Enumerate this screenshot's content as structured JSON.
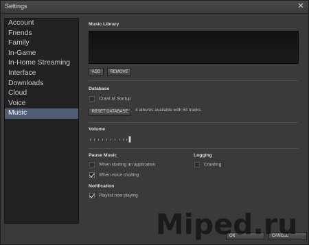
{
  "window": {
    "title": "Settings",
    "close_glyph": "✕"
  },
  "sidebar": {
    "items": [
      {
        "label": "Account"
      },
      {
        "label": "Friends"
      },
      {
        "label": "Family"
      },
      {
        "label": "In-Game"
      },
      {
        "label": "In-Home Streaming"
      },
      {
        "label": "Interface"
      },
      {
        "label": "Downloads"
      },
      {
        "label": "Cloud"
      },
      {
        "label": "Voice"
      },
      {
        "label": "Music"
      }
    ],
    "active": "Music"
  },
  "music_library": {
    "title": "Music Library",
    "add_label": "ADD",
    "remove_label": "REMOVE"
  },
  "database": {
    "title": "Database",
    "crawl_label": "Crawl at Startup",
    "crawl_checked": false,
    "reset_label": "RESET DATABASE",
    "status": "4 albums available with 54 tracks."
  },
  "volume": {
    "title": "Volume"
  },
  "pause_music": {
    "title": "Pause Music",
    "starting_app_label": "When starting an application",
    "starting_app_checked": false,
    "voice_chat_label": "When voice chatting",
    "voice_chat_checked": true
  },
  "logging": {
    "title": "Logging",
    "crawling_label": "Crawling",
    "crawling_checked": false
  },
  "notification": {
    "title": "Notification",
    "playlist_label": "Playlist now playing",
    "playlist_checked": true
  },
  "footer": {
    "ok_label": "OK",
    "cancel_label": "CANCEL"
  },
  "watermark": "Miped.ru"
}
